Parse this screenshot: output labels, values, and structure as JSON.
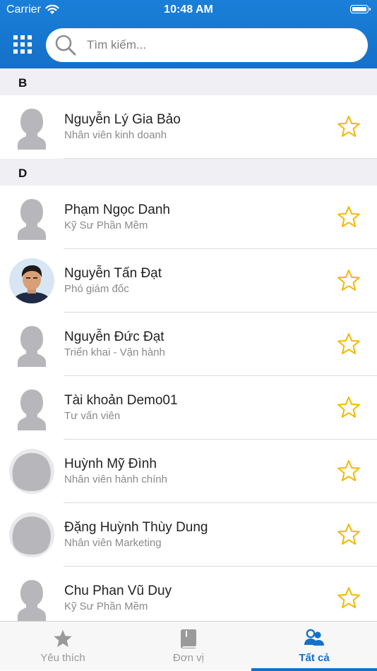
{
  "status_bar": {
    "carrier": "Carrier",
    "time": "10:48 AM"
  },
  "search": {
    "placeholder": "Tìm kiếm..."
  },
  "sections": [
    {
      "letter": "B",
      "contacts": [
        {
          "name": "Nguyễn Lý Gia Bảo",
          "role": "Nhân viên kinh doanh",
          "avatar": "default-avatar",
          "favorite": false
        }
      ]
    },
    {
      "letter": "D",
      "contacts": [
        {
          "name": "Phạm Ngọc Danh",
          "role": "Kỹ Sư Phần Mềm",
          "avatar": "default-avatar",
          "favorite": false
        },
        {
          "name": "Nguyễn Tấn Đạt",
          "role": "Phó giám đốc",
          "avatar": "photo-avatar",
          "favorite": false
        },
        {
          "name": "Nguyễn Đức Đạt",
          "role": "Triển khai - Vận hành",
          "avatar": "default-avatar",
          "favorite": false
        },
        {
          "name": "Tài khoản Demo01",
          "role": "Tư vấn viên",
          "avatar": "default-avatar",
          "favorite": false
        },
        {
          "name": "Huỳnh Mỹ Đình",
          "role": "Nhân viên hành chính",
          "avatar": "round-avatar",
          "favorite": false
        },
        {
          "name": "Đặng Huỳnh Thùy Dung",
          "role": "Nhân viên Marketing",
          "avatar": "round-avatar",
          "favorite": false
        },
        {
          "name": "Chu Phan Vũ Duy",
          "role": "Kỹ Sư Phần Mềm",
          "avatar": "default-avatar",
          "favorite": false
        }
      ]
    }
  ],
  "tabs": [
    {
      "label": "Yêu thích",
      "icon": "star-icon",
      "active": false
    },
    {
      "label": "Đơn vị",
      "icon": "book-icon",
      "active": false
    },
    {
      "label": "Tất cả",
      "icon": "people-icon",
      "active": true
    }
  ],
  "colors": {
    "primary": "#1570c8",
    "star": "#f5b800",
    "section_bg": "#efeff4",
    "inactive_tab": "#9a9a9a"
  }
}
